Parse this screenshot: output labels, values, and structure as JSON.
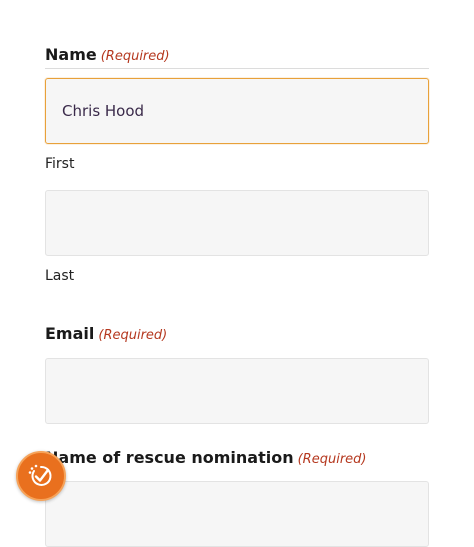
{
  "form": {
    "required_label": "(Required)",
    "name": {
      "legend": "Name",
      "first": {
        "value": "Chris Hood",
        "sublabel": "First"
      },
      "last": {
        "value": "",
        "sublabel": "Last"
      }
    },
    "email": {
      "legend": "Email",
      "value": ""
    },
    "rescue_nomination": {
      "legend": "Name of rescue nomination",
      "value": ""
    }
  },
  "accessibility_widget": {
    "icon": "accessibility-check-icon"
  },
  "colors": {
    "required": "#b5381f",
    "focus_border": "#e8a13a",
    "widget_bg": "#e9701e",
    "input_bg": "#f6f6f6"
  }
}
